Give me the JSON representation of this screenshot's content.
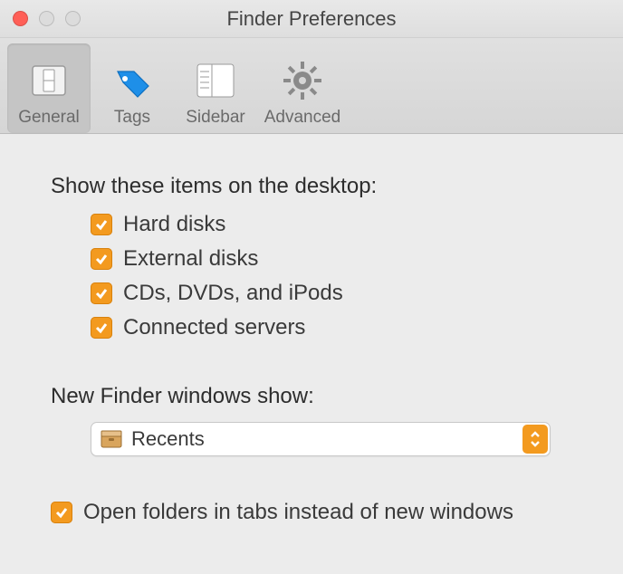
{
  "window": {
    "title": "Finder Preferences"
  },
  "toolbar": {
    "tabs": [
      {
        "label": "General",
        "selected": true
      },
      {
        "label": "Tags",
        "selected": false
      },
      {
        "label": "Sidebar",
        "selected": false
      },
      {
        "label": "Advanced",
        "selected": false
      }
    ]
  },
  "content": {
    "desktop_section_label": "Show these items on the desktop:",
    "desktop_items": [
      {
        "label": "Hard disks",
        "checked": true
      },
      {
        "label": "External disks",
        "checked": true
      },
      {
        "label": "CDs, DVDs, and iPods",
        "checked": true
      },
      {
        "label": "Connected servers",
        "checked": true
      }
    ],
    "new_finder_label": "New Finder windows show:",
    "new_finder_value": "Recents",
    "open_in_tabs": {
      "label": "Open folders in tabs instead of new windows",
      "checked": true
    }
  }
}
